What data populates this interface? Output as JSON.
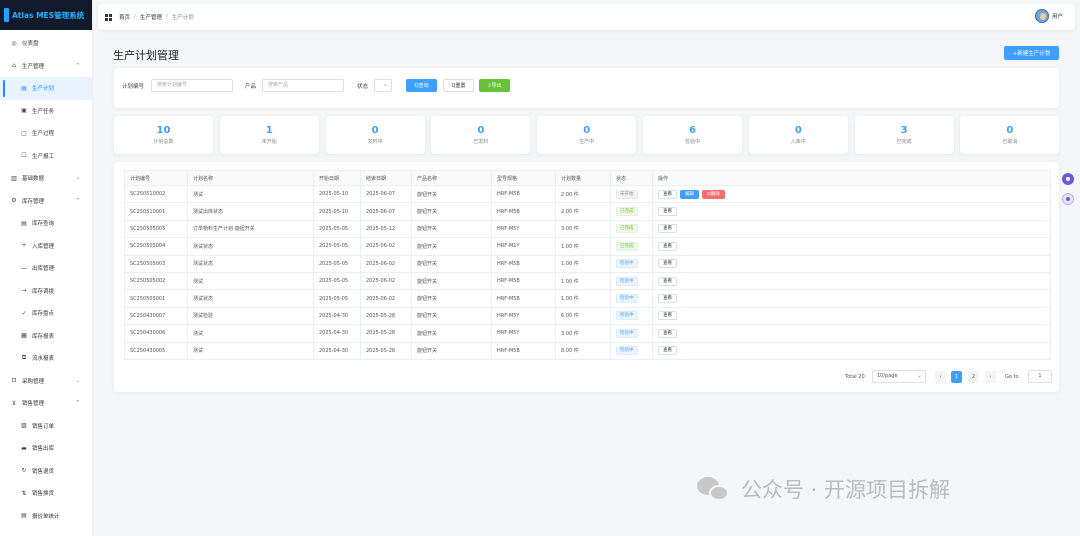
{
  "app": {
    "title": "Atlas MES管理系统"
  },
  "sidebar": {
    "items": [
      {
        "label": "仪表盘",
        "icon": "dashboard-icon",
        "glyph": "◎",
        "level": "top"
      },
      {
        "label": "生产管理",
        "icon": "factory-icon",
        "glyph": "⌂",
        "level": "top",
        "chevron": "^"
      },
      {
        "label": "生产计划",
        "icon": "calendar-icon",
        "glyph": "▤",
        "level": "sub",
        "active": true
      },
      {
        "label": "生产任务",
        "icon": "task-icon",
        "glyph": "▣",
        "level": "sub"
      },
      {
        "label": "生产过程",
        "icon": "process-icon",
        "glyph": "▢",
        "level": "sub"
      },
      {
        "label": "生产报工",
        "icon": "report-icon",
        "glyph": "☐",
        "level": "sub"
      },
      {
        "label": "基础数据",
        "icon": "database-icon",
        "glyph": "▥",
        "level": "top",
        "chevron": "⌄"
      },
      {
        "label": "库存管理",
        "icon": "inventory-icon",
        "glyph": "⚙",
        "level": "top",
        "chevron": "^"
      },
      {
        "label": "库存查询",
        "icon": "query-icon",
        "glyph": "▤",
        "level": "sub"
      },
      {
        "label": "入库管理",
        "icon": "plus-icon",
        "glyph": "+",
        "level": "sub"
      },
      {
        "label": "出库管理",
        "icon": "minus-icon",
        "glyph": "—",
        "level": "sub"
      },
      {
        "label": "库存调拨",
        "icon": "arrow-right-icon",
        "glyph": "→",
        "level": "sub"
      },
      {
        "label": "库存盘点",
        "icon": "check-icon",
        "glyph": "✓",
        "level": "sub"
      },
      {
        "label": "库存报表",
        "icon": "chart-icon",
        "glyph": "▦",
        "level": "sub"
      },
      {
        "label": "流水报表",
        "icon": "flow-icon",
        "glyph": "⧉",
        "level": "sub"
      },
      {
        "label": "采购管理",
        "icon": "cart-icon",
        "glyph": "⊡",
        "level": "top",
        "chevron": "⌄"
      },
      {
        "label": "销售管理",
        "icon": "shopping-cart-icon",
        "glyph": "⊻",
        "level": "top",
        "chevron": "^"
      },
      {
        "label": "销售订单",
        "icon": "order-icon",
        "glyph": "▧",
        "level": "sub"
      },
      {
        "label": "销售出库",
        "icon": "box-icon",
        "glyph": "▬",
        "level": "sub"
      },
      {
        "label": "销售退货",
        "icon": "refresh-icon",
        "glyph": "↻",
        "level": "sub"
      },
      {
        "label": "销售换货",
        "icon": "swap-icon",
        "glyph": "⇅",
        "level": "sub"
      },
      {
        "label": "报价单统计",
        "icon": "stats-icon",
        "glyph": "▤",
        "level": "sub"
      }
    ]
  },
  "header": {
    "breadcrumb": [
      "首页",
      "生产管理",
      "生产计划"
    ],
    "user": "用户"
  },
  "main": {
    "title": "生产计划管理",
    "new_button": "+新建生产计划"
  },
  "filters": {
    "plan_no_label": "计划编号",
    "plan_no_placeholder": "搜索计划编号",
    "product_label": "产品",
    "product_placeholder": "搜索产品",
    "status_label": "状态",
    "search_btn": "Q查询",
    "reset_btn": "Q重置",
    "export_btn": "⇩导出"
  },
  "stats": [
    {
      "value": "10",
      "label": "计划总数"
    },
    {
      "value": "1",
      "label": "未开始"
    },
    {
      "value": "0",
      "label": "发料中"
    },
    {
      "value": "0",
      "label": "已发料"
    },
    {
      "value": "0",
      "label": "生产中"
    },
    {
      "value": "6",
      "label": "检验中"
    },
    {
      "value": "0",
      "label": "入库中"
    },
    {
      "value": "3",
      "label": "已完成"
    },
    {
      "value": "0",
      "label": "已取消"
    }
  ],
  "table": {
    "headers": [
      "计划编号",
      "计划名称",
      "开始日期",
      "结束日期",
      "产品名称",
      "型号规格",
      "计划数量",
      "状态",
      "操作"
    ],
    "rows": [
      {
        "no": "SC250510002",
        "name": "测试",
        "start": "2025-05-10",
        "end": "2025-06-07",
        "product": "旋钮开关",
        "model": "HRF-M5B",
        "qty": "2.00 件",
        "status": "未开始",
        "status_type": "gray",
        "ops": [
          "查看",
          "编辑",
          "⊡删除"
        ]
      },
      {
        "no": "SC250510001",
        "name": "测试出库状态",
        "start": "2025-05-10",
        "end": "2025-06-07",
        "product": "旋钮开关",
        "model": "HRF-M5B",
        "qty": "2.00 件",
        "status": "已完成",
        "status_type": "green",
        "ops": [
          "查看"
        ]
      },
      {
        "no": "SC250505005",
        "name": "订单物料生产计划-旋钮开关",
        "start": "2025-05-05",
        "end": "2025-05-12",
        "product": "旋钮开关",
        "model": "HRF-M5Y",
        "qty": "3.00 件",
        "status": "已完成",
        "status_type": "green",
        "ops": [
          "查看"
        ]
      },
      {
        "no": "SC250505004",
        "name": "测试状态",
        "start": "2025-05-05",
        "end": "2025-06-02",
        "product": "旋钮开关",
        "model": "HRF-M1Y",
        "qty": "1.00 件",
        "status": "已完成",
        "status_type": "green",
        "ops": [
          "查看"
        ]
      },
      {
        "no": "SC250505003",
        "name": "测试状态",
        "start": "2025-05-05",
        "end": "2025-06-02",
        "product": "旋钮开关",
        "model": "HRF-M5B",
        "qty": "1.00 件",
        "status": "检验中",
        "status_type": "blue",
        "ops": [
          "查看"
        ]
      },
      {
        "no": "SC250505002",
        "name": "测试",
        "start": "2025-05-05",
        "end": "2025-06-02",
        "product": "旋钮开关",
        "model": "HRF-M5B",
        "qty": "1.00 件",
        "status": "检验中",
        "status_type": "blue",
        "ops": [
          "查看"
        ]
      },
      {
        "no": "SC250505001",
        "name": "测试状态",
        "start": "2025-05-05",
        "end": "2025-06-02",
        "product": "旋钮开关",
        "model": "HRF-M5B",
        "qty": "1.00 件",
        "status": "检验中",
        "status_type": "blue",
        "ops": [
          "查看"
        ]
      },
      {
        "no": "SC250430007",
        "name": "测试检验",
        "start": "2025-04-30",
        "end": "2025-05-28",
        "product": "旋钮开关",
        "model": "HRF-M5Y",
        "qty": "6.00 件",
        "status": "检验中",
        "status_type": "blue",
        "ops": [
          "查看"
        ]
      },
      {
        "no": "SC250430006",
        "name": "测试",
        "start": "2025-04-30",
        "end": "2025-05-28",
        "product": "旋钮开关",
        "model": "HRF-M5Y",
        "qty": "3.00 件",
        "status": "检验中",
        "status_type": "blue",
        "ops": [
          "查看"
        ]
      },
      {
        "no": "SC250430005",
        "name": "测试",
        "start": "2025-04-30",
        "end": "2025-05-28",
        "product": "旋钮开关",
        "model": "HRF-M5B",
        "qty": "8.00 件",
        "status": "检验中",
        "status_type": "blue",
        "ops": [
          "查看"
        ]
      }
    ]
  },
  "pagination": {
    "total": "Total 20",
    "page_size": "10/page",
    "prev": "‹",
    "pages": [
      "1",
      "2"
    ],
    "current": "1",
    "next": "›",
    "goto_label": "Go to",
    "goto_value": "1"
  },
  "watermark": {
    "text": "公众号 · 开源项目拆解"
  },
  "colors": {
    "primary": "#409eff",
    "success": "#67c23a",
    "danger": "#f56c6c",
    "logo_bg": "#101a2b"
  }
}
